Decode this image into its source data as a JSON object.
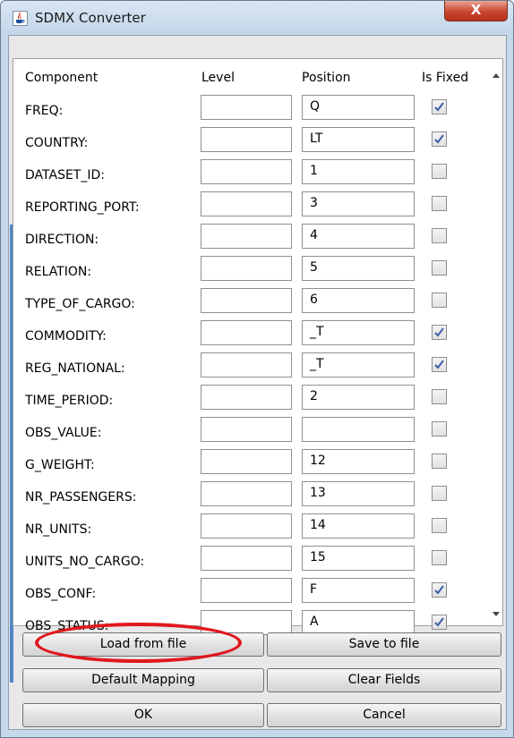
{
  "window": {
    "title": "SDMX Converter",
    "close_glyph": "X"
  },
  "table": {
    "headers": {
      "component": "Component",
      "level": "Level",
      "position": "Position",
      "is_fixed": "Is Fixed"
    },
    "rows": [
      {
        "component": "FREQ:",
        "level": "",
        "position": "Q",
        "fixed": true
      },
      {
        "component": "COUNTRY:",
        "level": "",
        "position": "LT",
        "fixed": true
      },
      {
        "component": "DATASET_ID:",
        "level": "",
        "position": "1",
        "fixed": false
      },
      {
        "component": "REPORTING_PORT:",
        "level": "",
        "position": "3",
        "fixed": false
      },
      {
        "component": "DIRECTION:",
        "level": "",
        "position": "4",
        "fixed": false
      },
      {
        "component": "RELATION:",
        "level": "",
        "position": "5",
        "fixed": false
      },
      {
        "component": "TYPE_OF_CARGO:",
        "level": "",
        "position": "6",
        "fixed": false
      },
      {
        "component": "COMMODITY:",
        "level": "",
        "position": "_T",
        "fixed": true
      },
      {
        "component": "REG_NATIONAL:",
        "level": "",
        "position": "_T",
        "fixed": true
      },
      {
        "component": "TIME_PERIOD:",
        "level": "",
        "position": "2",
        "fixed": false
      },
      {
        "component": "OBS_VALUE:",
        "level": "",
        "position": "",
        "fixed": false
      },
      {
        "component": "G_WEIGHT:",
        "level": "",
        "position": "12",
        "fixed": false
      },
      {
        "component": "NR_PASSENGERS:",
        "level": "",
        "position": "13",
        "fixed": false
      },
      {
        "component": "NR_UNITS:",
        "level": "",
        "position": "14",
        "fixed": false
      },
      {
        "component": "UNITS_NO_CARGO:",
        "level": "",
        "position": "15",
        "fixed": false
      },
      {
        "component": "OBS_CONF:",
        "level": "",
        "position": "F",
        "fixed": true
      },
      {
        "component": "OBS_STATUS:",
        "level": "",
        "position": "A",
        "fixed": true
      }
    ]
  },
  "buttons": {
    "load": "Load from file",
    "save": "Save to file",
    "default_mapping": "Default Mapping",
    "clear": "Clear Fields",
    "ok": "OK",
    "cancel": "Cancel"
  },
  "colors": {
    "highlight": "#e0181e",
    "check": "#3a5fa8"
  },
  "icons": {
    "app": "java-cup-icon",
    "close": "close-icon"
  }
}
